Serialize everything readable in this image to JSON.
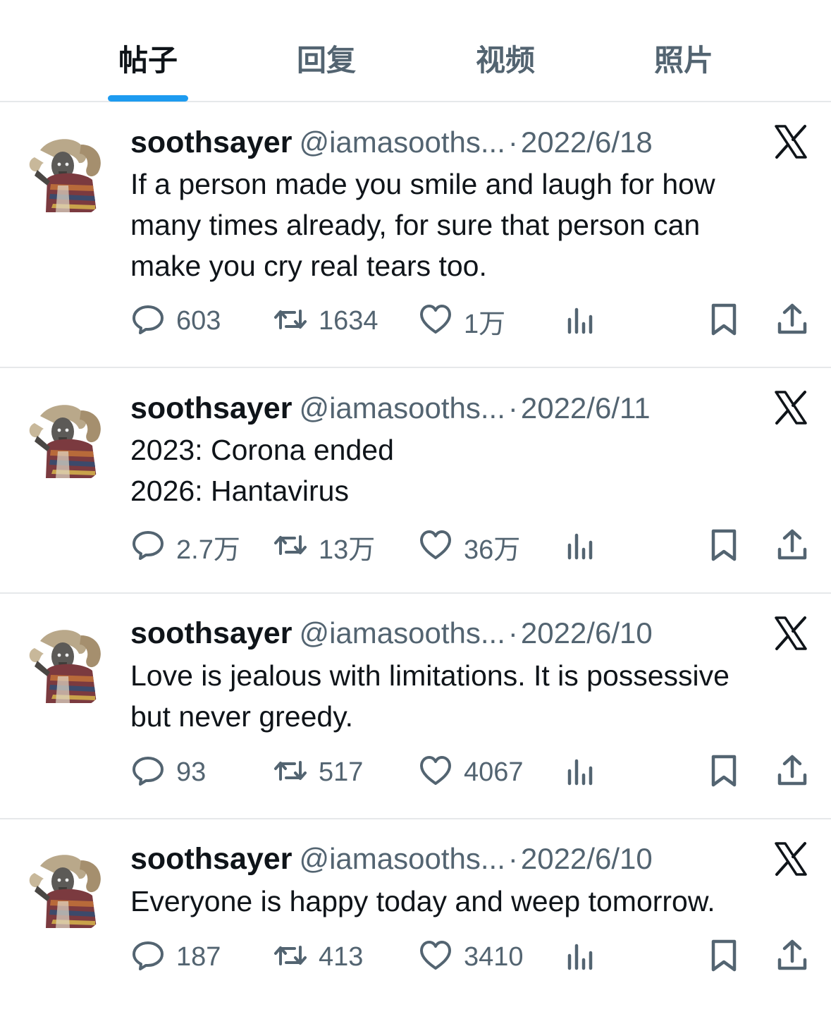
{
  "tabs": [
    {
      "label": "帖子",
      "active": true
    },
    {
      "label": "回复",
      "active": false
    },
    {
      "label": "视频",
      "active": false
    },
    {
      "label": "照片",
      "active": false
    }
  ],
  "accent_color": "#1d9bf0",
  "posts": [
    {
      "author": "soothsayer",
      "handle": "@iamasooths...",
      "separator": "·",
      "date": "2022/6/18",
      "lines": [
        "If a person made you smile and laugh for how",
        "many times already, for sure that person can",
        "make you cry real tears too."
      ],
      "replies": "603",
      "reposts": "1634",
      "likes": "1万"
    },
    {
      "author": "soothsayer",
      "handle": "@iamasooths...",
      "separator": "·",
      "date": "2022/6/11",
      "lines": [
        "2023: Corona ended",
        "2026: Hantavirus"
      ],
      "replies": "2.7万",
      "reposts": "13万",
      "likes": "36万"
    },
    {
      "author": "soothsayer",
      "handle": "@iamasooths...",
      "separator": "·",
      "date": "2022/6/10",
      "lines": [
        "Love is jealous with limitations. It is possessive",
        "but never greedy."
      ],
      "replies": "93",
      "reposts": "517",
      "likes": "4067"
    },
    {
      "author": "soothsayer",
      "handle": "@iamasooths...",
      "separator": "·",
      "date": "2022/6/10",
      "lines": [
        "Everyone is happy today and weep tomorrow."
      ],
      "replies": "187",
      "reposts": "413",
      "likes": "3410"
    }
  ],
  "icons": {
    "reply": "speech-bubble-icon",
    "repost": "repost-arrows-icon",
    "like": "heart-icon",
    "views": "bar-chart-icon",
    "bookmark": "bookmark-icon",
    "share": "share-upload-icon",
    "platform": "x-logo-icon"
  }
}
